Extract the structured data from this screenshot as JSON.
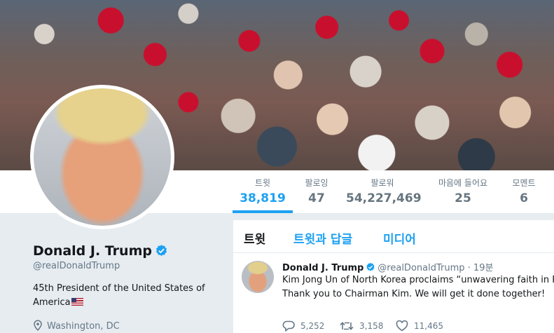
{
  "profile": {
    "stats": [
      {
        "label": "트윗",
        "value": "38,819"
      },
      {
        "label": "팔로잉",
        "value": "47"
      },
      {
        "label": "팔로워",
        "value": "54,227,469"
      },
      {
        "label": "마음에 들어요",
        "value": "25"
      },
      {
        "label": "모멘트",
        "value": "6"
      }
    ],
    "name": "Donald J. Trump",
    "handle": "@realDonaldTrump",
    "bio": "45th President of the United States of America",
    "location": "Washington, DC"
  },
  "timeline": {
    "tabs": [
      "트윗",
      "트윗과 답글",
      "미디어"
    ],
    "tweet": {
      "name": "Donald J. Trump",
      "handle": "@realDonaldTrump",
      "separator": "·",
      "time": "19분",
      "line1": "Kim Jong Un of North Korea proclaims “unwavering faith in Pre",
      "line2": "Thank you to Chairman Kim. We will get it done together!",
      "replies": "5,252",
      "retweets": "3,158",
      "likes": "11,465"
    }
  },
  "colors": {
    "accent": "#1da1f2",
    "text": "#14171a",
    "muted": "#657786",
    "background": "#e6ecf0"
  },
  "icons": [
    "verified-badge-icon",
    "us-flag-icon",
    "location-pin-icon",
    "reply-icon",
    "retweet-icon",
    "like-icon"
  ]
}
